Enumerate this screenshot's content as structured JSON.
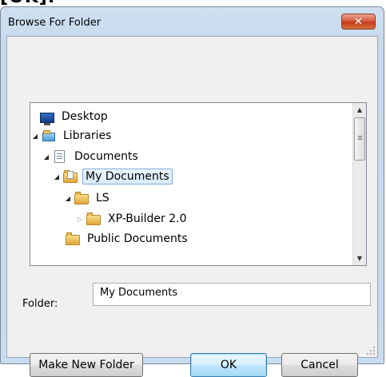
{
  "top_partial_text": "[OK].",
  "dialog": {
    "title": "Browse For Folder",
    "close_label": "✕"
  },
  "tree": {
    "items": [
      {
        "label": "Desktop",
        "icon": "desktop-icon",
        "expander": "none"
      },
      {
        "label": "Libraries",
        "icon": "libraries-icon",
        "expander": "expanded"
      },
      {
        "label": "Documents",
        "icon": "document-library-icon",
        "expander": "expanded"
      },
      {
        "label": "My Documents",
        "icon": "folder-icon",
        "expander": "expanded",
        "selected": true
      },
      {
        "label": "LS",
        "icon": "folder-icon",
        "expander": "expanded"
      },
      {
        "label": "XP-Builder 2.0",
        "icon": "folder-icon",
        "expander": "collapsed"
      },
      {
        "label": "Public Documents",
        "icon": "folder-icon",
        "expander": "none"
      }
    ]
  },
  "folder_field": {
    "label": "Folder:",
    "value": "My Documents"
  },
  "buttons": {
    "make_new_folder": "Make New Folder",
    "ok": "OK",
    "cancel": "Cancel"
  },
  "colors": {
    "selection_border": "#84acdd",
    "close_button": "#c33a1c",
    "window_frame": "#c5d8ec"
  }
}
